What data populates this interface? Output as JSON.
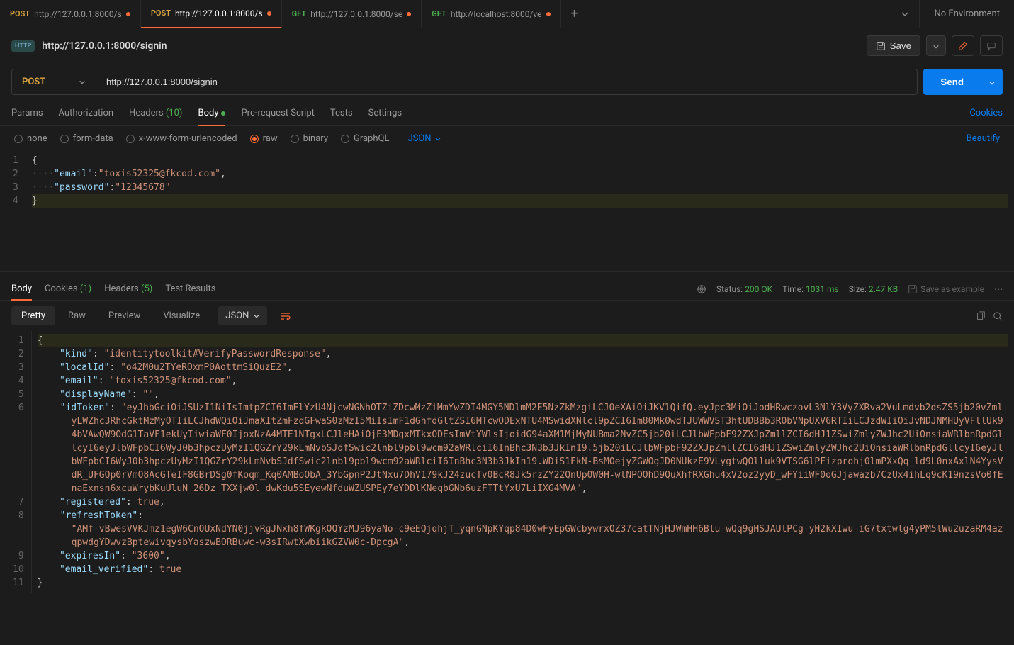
{
  "topTabs": [
    {
      "method": "POST",
      "label": "http://127.0.0.1:8000/s",
      "modified": true,
      "active": false
    },
    {
      "method": "POST",
      "label": "http://127.0.0.1:8000/s",
      "modified": true,
      "active": true
    },
    {
      "method": "GET",
      "label": "http://127.0.0.1:8000/se",
      "modified": true,
      "active": false
    },
    {
      "method": "GET",
      "label": "http://localhost:8000/ve",
      "modified": true,
      "active": false
    }
  ],
  "environment": "No Environment",
  "request": {
    "title": "http://127.0.0.1:8000/signin",
    "method": "POST",
    "url": "http://127.0.0.1:8000/signin",
    "saveLabel": "Save",
    "sendLabel": "Send"
  },
  "reqTabs": {
    "params": "Params",
    "auth": "Authorization",
    "headers": "Headers",
    "headersCount": "(10)",
    "body": "Body",
    "prescript": "Pre-request Script",
    "tests": "Tests",
    "settings": "Settings",
    "cookies": "Cookies"
  },
  "bodyTypes": {
    "none": "none",
    "formdata": "form-data",
    "xwww": "x-www-form-urlencoded",
    "raw": "raw",
    "binary": "binary",
    "graphql": "GraphQL",
    "format": "JSON",
    "beautify": "Beautify"
  },
  "requestBody": {
    "emailKey": "\"email\"",
    "emailVal": "\"toxis52325@fkcod.com\"",
    "passwordKey": "\"password\"",
    "passwordVal": "\"12345678\""
  },
  "responseTabs": {
    "body": "Body",
    "cookies": "Cookies",
    "cookiesCount": "(1)",
    "headers": "Headers",
    "headersCount": "(5)",
    "testResults": "Test Results"
  },
  "responseMeta": {
    "statusLabel": "Status:",
    "statusValue": "200 OK",
    "timeLabel": "Time:",
    "timeValue": "1031 ms",
    "sizeLabel": "Size:",
    "sizeValue": "2.47 KB",
    "saveExample": "Save as example"
  },
  "viewTabs": {
    "pretty": "Pretty",
    "raw": "Raw",
    "preview": "Preview",
    "visualize": "Visualize",
    "format": "JSON"
  },
  "responseBody": {
    "kind_k": "\"kind\"",
    "kind_v": "\"identitytoolkit#VerifyPasswordResponse\"",
    "localId_k": "\"localId\"",
    "localId_v": "\"o42M0u2TYeROxmP0AottmSiQuzE2\"",
    "email_k": "\"email\"",
    "email_v": "\"toxis52325@fkcod.com\"",
    "displayName_k": "\"displayName\"",
    "displayName_v": "\"\"",
    "idToken_k": "\"idToken\"",
    "idToken_v": "\"eyJhbGciOiJSUzI1NiIsImtpZCI6ImFlYzU4NjcwNGNhOTZiZDcwMzZiMmYwZDI4MGY5NDlmM2E5NzZkMzgiLCJ0eXAiOiJKV1QifQ.eyJpc3MiOiJodHRwczovL3NlY3VyZXRva2VuLmdvb2dsZS5jb20vZmlyLWZhc3RhcGktMzMyOTIiLCJhdWQiOiJmaXItZmFzdGFwaS0zMzI5MiIsImF1dGhfdGltZSI6MTcwODExNTU4MSwidXNlcl9pZCI6Im80Mk0wdTJUWWVST3htUDBBb3R0bVNpUXV6RTIiLCJzdWIiOiJvNDJNMHUyVFllUk94bVAwQW9OdG1TaVF1ekUyIiwiaWF0IjoxNzA4MTE1NTgxLCJleHAiOjE3MDgxMTkxODEsImVtYWlsIjoidG94aXM1MjMyNUBma2NvZC5jb20iLCJlbWFpbF92ZXJpZmllZCI6dHJ1ZSwiZmlyZWJhc2UiOnsiaWRlbnRpdGllcyI6eyJlbWFpbCI6WyJ0b3hpczUyMzI1QGZrY29kLmNvbSJdfSwic2lnbl9pbl9wcm92aWRlciI6InBhc3N3b3JkIn19.5jb20iLCJlbWFpbF92ZXJpZmllZCI6dHJ1ZSwiZmlyZWJhc2UiOnsiaWRlbnRpdGllcyI6eyJlbWFpbCI6WyJ0b3hpczUyMzI1QGZrY29kLmNvbSJdfSwic2lnbl9pbl9wcm92aWRlciI6InBhc3N3b3JkIn19.WDiS1FkN-BsMOejyZGWOgJD0NUkzE9VLygtwQOlluk9VTSG6lPFizprohj0lmPXxQq_ld9L0nxAxlN4YysVdR_UFGQp0rVmO8AcGTeIF8GBrDSg0fKoqm_Kq0AMBoObA_3YbGpnP2JtNxu7DhV179kJ24zucTv0BcR8Jk5rzZY22QnUp0W0H-wlNPOOhD9QuXhfRXGhu4xV2oz2yyD_wFYiiWF0oGJjawazb7CzUx4ihLq9cK19nzsVo0fEnaExnsn6xcuWrybKuUluN_26Dz_TXXjw0l_dwKdu5SEyewNfduWZUSPEy7eYDDlKNeqbGNb6uzFTTtYxU7LiIXG4MVA\"",
    "registered_k": "\"registered\"",
    "registered_v": "true",
    "refreshToken_k": "\"refreshToken\"",
    "refreshToken_v": "\"AMf-vBwesVVKJmz1egW6CnOUxNdYN0jjvRgJNxh8fWKgkOQYzMJ96yaNo-c9eEQjqhjT_yqnGNpKYqp84D0wFyEpGWcbywrxOZ37catTNjHJWmHH6Blu-wQq9gHSJAUlPCg-yH2kXIwu-iG7txtwlg4yPM5lWu2uzaRM4azqpwdgYDwvzBptewivqysbYaszwBORBuwc-w3sIRwtXwbiikGZVW0c-DpcgA\"",
    "expiresIn_k": "\"expiresIn\"",
    "expiresIn_v": "\"3600\"",
    "emailVerified_k": "\"email_verified\"",
    "emailVerified_v": "true"
  }
}
